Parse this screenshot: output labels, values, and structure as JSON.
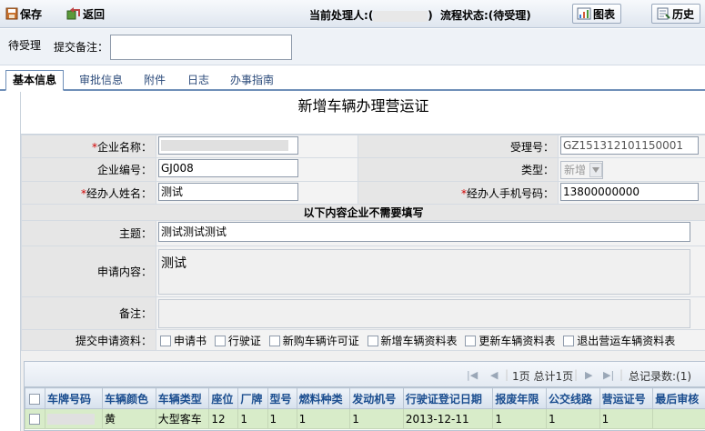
{
  "toolbar": {
    "save_label": "保存",
    "back_label": "返回",
    "handler_label": "当前处理人:",
    "handler_value": "(",
    "handler_suffix": ")",
    "flow_status": "流程状态:(待受理)",
    "chart_label": "图表",
    "history_label": "历史"
  },
  "pending": {
    "status_label": "待受理",
    "remark_label": "提交备注：",
    "remark_value": ""
  },
  "tabs": [
    {
      "label": "基本信息",
      "active": true
    },
    {
      "label": "审批信息",
      "active": false
    },
    {
      "label": "附件",
      "active": false
    },
    {
      "label": "日志",
      "active": false
    },
    {
      "label": "办事指南",
      "active": false
    }
  ],
  "form": {
    "title": "新增车辆办理营运证",
    "company_name_label": "企业名称：",
    "company_name_value": "",
    "accept_no_label": "受理号：",
    "accept_no_value": "GZ151312101150001",
    "company_code_label": "企业编号：",
    "company_code_value": "GJ008",
    "type_label": "类型：",
    "type_value": "新增",
    "handler_name_label": "经办人姓名：",
    "handler_name_value": "测试",
    "handler_phone_label": "经办人手机号码：",
    "handler_phone_value": "13800000000",
    "section_head": "以下内容企业不需要填写",
    "subject_label": "主题：",
    "subject_value": "测试测试测试",
    "content_label": "申请内容：",
    "content_value": "测试",
    "note_label": "备注：",
    "note_value": "",
    "materials_label": "提交申请资料：",
    "materials": [
      "申请书",
      "行驶证",
      "新购车辆许可证",
      "新增车辆资料表",
      "更新车辆资料表",
      "退出营运车辆资料表"
    ]
  },
  "grid": {
    "pager_text": "1页 总计1页",
    "total_text": "总记录数:(1)",
    "columns": [
      "车牌号码",
      "车辆颜色",
      "车辆类型",
      "座位",
      "厂牌",
      "型号",
      "燃料种类",
      "发动机号",
      "行驶证登记日期",
      "报废年限",
      "公交线路",
      "营运证号",
      "最后审核"
    ],
    "row": {
      "plate": "粤A0312",
      "color": "黄",
      "vehicle_type": "大型客车",
      "seats": "12",
      "brand": "1",
      "model": "1",
      "fuel": "1",
      "engine": "1",
      "reg_date": "2013-12-11",
      "scrap_years": "1",
      "bus_line": "1",
      "license_no": "1",
      "last_review": ""
    }
  }
}
